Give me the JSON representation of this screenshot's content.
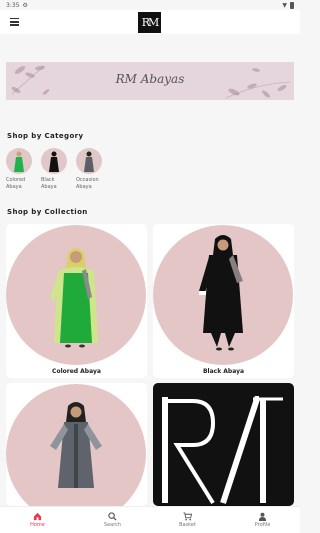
{
  "status_bar": {
    "time": "3:35"
  },
  "app_bar": {
    "logo_text": "RM"
  },
  "banner": {
    "text": "RM Abayas"
  },
  "sections": {
    "category_title": "Shop by Category",
    "collection_title": "Shop by Collection"
  },
  "categories": [
    {
      "label": "Colored Abaya",
      "dress_color": "#22b14c"
    },
    {
      "label": "Black Abaya",
      "dress_color": "#111111"
    },
    {
      "label": "Occasion Abaya",
      "dress_color": "#555555"
    }
  ],
  "collections": [
    {
      "label": "Colored Abaya"
    },
    {
      "label": "Black Abaya"
    },
    {
      "label": ""
    },
    {
      "label": ""
    }
  ],
  "bottom_nav": [
    {
      "label": "Home",
      "icon": "home-icon",
      "active": true
    },
    {
      "label": "Search",
      "icon": "search-icon",
      "active": false
    },
    {
      "label": "Basket",
      "icon": "cart-icon",
      "active": false
    },
    {
      "label": "Profile",
      "icon": "person-icon",
      "active": false
    }
  ],
  "colors": {
    "accent": "#e53955",
    "circle": "#e5c6c6",
    "banner": "#e4d6dc"
  }
}
